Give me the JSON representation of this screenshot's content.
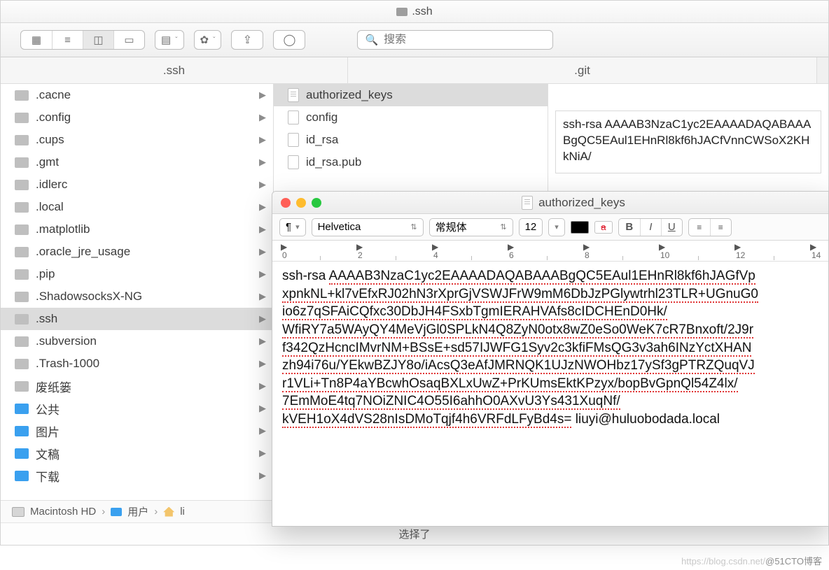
{
  "finder": {
    "title": ".ssh",
    "toolbar": {
      "search_placeholder": "搜索"
    },
    "tabs": {
      "left": ".ssh",
      "right": ".git"
    },
    "col1": [
      {
        "name": ".cacne",
        "type": "grey",
        "chev": true
      },
      {
        "name": ".config",
        "type": "grey",
        "chev": true
      },
      {
        "name": ".cups",
        "type": "grey",
        "chev": true
      },
      {
        "name": ".gmt",
        "type": "grey",
        "chev": true
      },
      {
        "name": ".idlerc",
        "type": "grey",
        "chev": true
      },
      {
        "name": ".local",
        "type": "grey",
        "chev": true
      },
      {
        "name": ".matplotlib",
        "type": "grey",
        "chev": true
      },
      {
        "name": ".oracle_jre_usage",
        "type": "grey",
        "chev": true
      },
      {
        "name": ".pip",
        "type": "grey",
        "chev": true
      },
      {
        "name": ".ShadowsocksX-NG",
        "type": "grey",
        "chev": true
      },
      {
        "name": ".ssh",
        "type": "grey",
        "chev": true,
        "selected": true
      },
      {
        "name": ".subversion",
        "type": "grey",
        "chev": true
      },
      {
        "name": ".Trash-1000",
        "type": "grey",
        "chev": true
      },
      {
        "name": "废纸篓",
        "type": "grey",
        "chev": true
      },
      {
        "name": "公共",
        "type": "blue",
        "chev": true
      },
      {
        "name": "图片",
        "type": "cam",
        "chev": true
      },
      {
        "name": "文稿",
        "type": "blue",
        "chev": true
      },
      {
        "name": "下载",
        "type": "blue",
        "chev": true
      }
    ],
    "col2": [
      {
        "name": "authorized_keys",
        "icon": "txt",
        "selected": true
      },
      {
        "name": "config",
        "icon": "blank"
      },
      {
        "name": "id_rsa",
        "icon": "blank"
      },
      {
        "name": "id_rsa.pub",
        "icon": "blank"
      }
    ],
    "preview_text": "ssh-rsa AAAAB3NzaC1yc2EAAAADAQABAAABgQC5EAul1EHnRl8kf6hJACfVnnCWSoX2KHkNiA/",
    "path": {
      "disk": "Macintosh HD",
      "users": "用户",
      "home": "li"
    },
    "status": "选择了"
  },
  "textedit": {
    "title": "authorized_keys",
    "font_family": "Helvetica",
    "style_label": "常规体",
    "font_size": "12",
    "para_label": "¶",
    "ruler_marks": [
      0,
      2,
      4,
      6,
      8,
      10,
      12,
      14
    ],
    "body_prefix": "ssh-rsa ",
    "body_lines": [
      "AAAAB3NzaC1yc2EAAAADAQABAAABgQC5EAul1EHnRl8kf6hJAGfVp",
      "xpnkNL+kl7vEfxRJ02hN3rXprGjVSWJFrW9mM6DbJzPGlywtrhl23TLR+UGnuG0",
      "io6z7qSFAiCQfxc30DbJH4FSxbTgmIERAHVAfs8cIDCHEnD0Hk/",
      "WfiRY7a5WAyQY4MeVjGl0SPLkN4Q8ZyN0otx8wZ0eSo0WeK7cR7Bnxoft/2J9r",
      "f342QzHcncIMvrNM+BSsE+sd57IJWFG1Syv2c3kfiFMsQG3v3ah6INzYctXHAN",
      "zh94i76u/YEkwBZJY8o/iAcsQ3eAfJMRNQK1UJzNWOHbz17ySf3gPTRZQuqVJ",
      "r1VLi+Tn8P4aYBcwhOsaqBXLxUwZ+PrKUmsEktKPzyx/bopBvGpnQl54Z4lx/",
      "7EmMoE4tq7NOiZNIC4O55I6ahhO0AXvU3Ys431XuqNf/"
    ],
    "body_tail": "kVEH1oX4dVS28nIsDMoTqjf4h6VRFdLFyBd4s=",
    "body_suffix": " liuyi@huluobodada.local"
  },
  "watermark": {
    "faint": "https://blog.csdn.net/",
    "bold": "@51CTO博客"
  }
}
